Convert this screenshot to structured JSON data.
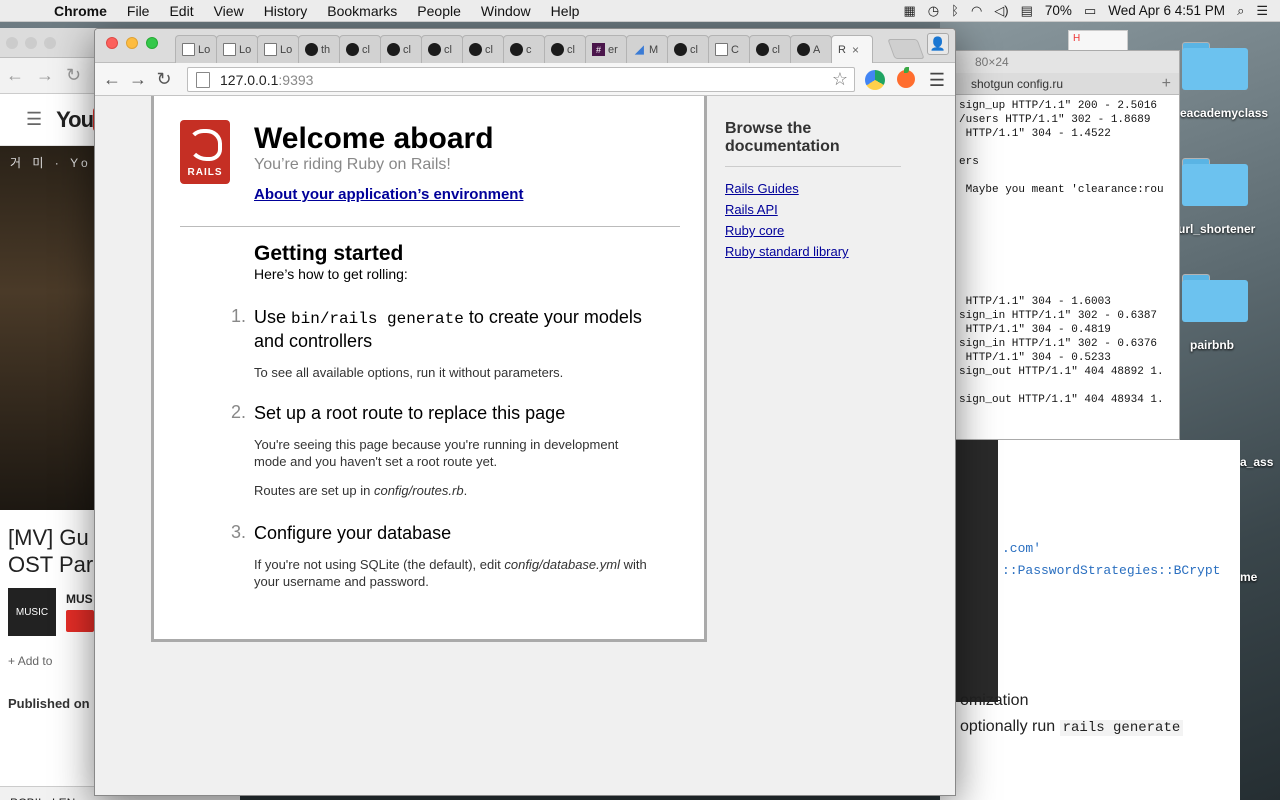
{
  "menubar": {
    "app_name": "Chrome",
    "items": [
      "File",
      "Edit",
      "View",
      "History",
      "Bookmarks",
      "People",
      "Window",
      "Help"
    ],
    "battery": "70%",
    "datetime": "Wed Apr 6  4:51 PM"
  },
  "desktop": {
    "folders": [
      "eacademyclass",
      "url_shortener",
      "pairbnb",
      "a_ass",
      "me"
    ]
  },
  "bg_youtube": {
    "overlay": "거 미 · Yo",
    "title_line1": "[MV] Gu",
    "title_line2": "OST Par",
    "channel": "MUS",
    "channel_thumb": "MUSIC",
    "add_to": "Add to",
    "published": "Published on M",
    "download": "PCBII - LEN"
  },
  "terminal": {
    "size": "80×24",
    "tab": "shotgun config.ru",
    "lines": [
      "sign_up HTTP/1.1\" 200 - 2.5016",
      "/users HTTP/1.1\" 302 - 1.8689",
      " HTTP/1.1\" 304 - 1.4522",
      "",
      "ers",
      "",
      " Maybe you meant 'clearance:rou",
      "",
      "",
      "",
      "",
      "",
      "",
      "",
      " HTTP/1.1\" 304 - 1.6003",
      "sign_in HTTP/1.1\" 302 - 0.6387",
      " HTTP/1.1\" 304 - 0.4819",
      "sign_in HTTP/1.1\" 302 - 0.6376",
      " HTTP/1.1\" 304 - 0.5233",
      "sign_out HTTP/1.1\" 404 48892 1.",
      "",
      "sign_out HTTP/1.1\" 404 48934 1."
    ]
  },
  "editor": {
    "code_line1": ".com'",
    "code_line2": "::PasswordStrategies::BCrypt",
    "section": "omization",
    "section_text": "optionally run",
    "section_code": "rails generate"
  },
  "browser": {
    "tabs": [
      {
        "icon": "doc",
        "label": "Lo"
      },
      {
        "icon": "doc",
        "label": "Lo"
      },
      {
        "icon": "doc",
        "label": "Lo"
      },
      {
        "icon": "github",
        "label": "th"
      },
      {
        "icon": "github",
        "label": "cl"
      },
      {
        "icon": "github",
        "label": "cl"
      },
      {
        "icon": "github",
        "label": "cl"
      },
      {
        "icon": "github",
        "label": "cl"
      },
      {
        "icon": "github",
        "label": "c"
      },
      {
        "icon": "github",
        "label": "cl"
      },
      {
        "icon": "slack",
        "label": "er"
      },
      {
        "icon": "m",
        "label": "M"
      },
      {
        "icon": "github",
        "label": "cl"
      },
      {
        "icon": "doc",
        "label": "C"
      },
      {
        "icon": "github",
        "label": "cl"
      },
      {
        "icon": "github",
        "label": "A"
      },
      {
        "icon": "none",
        "label": "R",
        "active": true
      }
    ],
    "url_host": "127.0.0.1",
    "url_port": ":9393"
  },
  "rails": {
    "title": "Welcome aboard",
    "subtitle": "You’re riding Ruby on Rails!",
    "about_link": "About your application’s environment",
    "logo_text": "RAILS",
    "getting_started": "Getting started",
    "getting_started_sub": "Here’s how to get rolling:",
    "steps": [
      {
        "num": "1.",
        "head_pre": "Use ",
        "head_code": "bin/rails generate",
        "head_post": " to create your models and controllers",
        "body": "To see all available options, run it without parameters."
      },
      {
        "num": "2.",
        "head": "Set up a root route to replace this page",
        "body1": "You're seeing this page because you're running in development mode and you haven't set a root route yet.",
        "body2_pre": "Routes are set up in ",
        "body2_em": "config/routes.rb",
        "body2_post": "."
      },
      {
        "num": "3.",
        "head": "Configure your database",
        "body_pre": "If you're not using SQLite (the default), edit ",
        "body_em": "config/database.yml",
        "body_post": " with your username and password."
      }
    ],
    "docs_title": "Browse the documentation",
    "docs_links": [
      "Rails Guides",
      "Rails API",
      "Ruby core",
      "Ruby standard library"
    ]
  }
}
